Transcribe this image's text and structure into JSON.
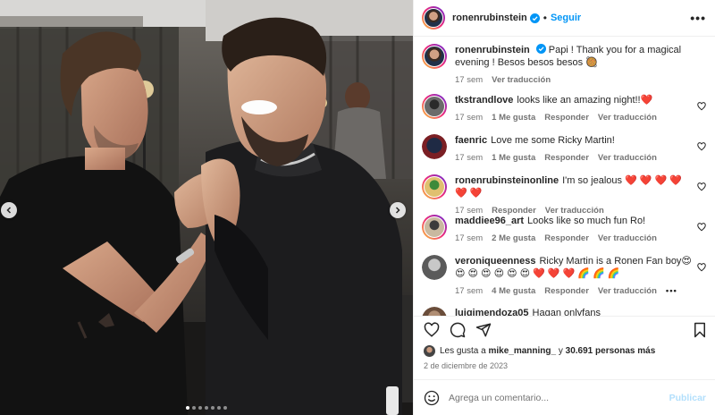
{
  "post": {
    "author": "ronenrubinstein",
    "follow_label": "Seguir",
    "separator": "•",
    "caption_author": "ronenrubinstein",
    "caption_text": "Papi ! Thank you for a magical evening ! Besos besos besos 🥘",
    "caption_age": "17 sem",
    "caption_translate": "Ver traducción"
  },
  "comments": [
    {
      "user": "tkstrandlove",
      "text": "looks like an amazing night!!❤️",
      "age": "17 sem",
      "likes": "1 Me gusta",
      "reply": "Responder",
      "translate": "Ver traducción"
    },
    {
      "user": "faenric",
      "text": "Love me some Ricky Martin!",
      "age": "17 sem",
      "likes": "1 Me gusta",
      "reply": "Responder",
      "translate": "Ver traducción"
    },
    {
      "user": "ronenrubinsteinonline",
      "text": "I'm so jealous ❤️ ❤️ ❤️ ❤️ ❤️ ❤️",
      "age": "17 sem",
      "likes": "",
      "reply": "Responder",
      "translate": "Ver traducción"
    },
    {
      "user": "maddiee96_art",
      "text": "Looks like so much fun Ro!",
      "age": "17 sem",
      "likes": "2 Me gusta",
      "reply": "Responder",
      "translate": "Ver traducción"
    },
    {
      "user": "veroniqueenness",
      "text": "Ricky Martin is a Ronen Fan boy😍 😍 😍 😍 😍 😍 😍 ❤️ ❤️ ❤️ 🌈 🌈 🌈",
      "age": "17 sem",
      "likes": "4 Me gusta",
      "reply": "Responder",
      "translate": "Ver traducción",
      "more": "•••"
    },
    {
      "user": "luigimendoza05",
      "text": "Hagan onlyfans",
      "age": "",
      "likes": "",
      "reply": "",
      "translate": ""
    }
  ],
  "likes_bar": {
    "prefix": "Les gusta a",
    "user": "mike_manning_",
    "middle": "y",
    "count": "30.691 personas más"
  },
  "date": "2 de diciembre de 2023",
  "comment_box": {
    "placeholder": "Agrega un comentario...",
    "publish": "Publicar"
  },
  "carousel": {
    "dots": 7,
    "active_index": 0
  },
  "colors": {
    "accent": "#0095f6",
    "heart": "#ed4956",
    "meta": "#737373"
  },
  "icons": [
    "more-options-icon",
    "verified-badge-icon",
    "heart-icon",
    "comment-icon",
    "share-icon",
    "bookmark-icon",
    "emoji-icon",
    "chevron-left-icon",
    "chevron-right-icon"
  ]
}
